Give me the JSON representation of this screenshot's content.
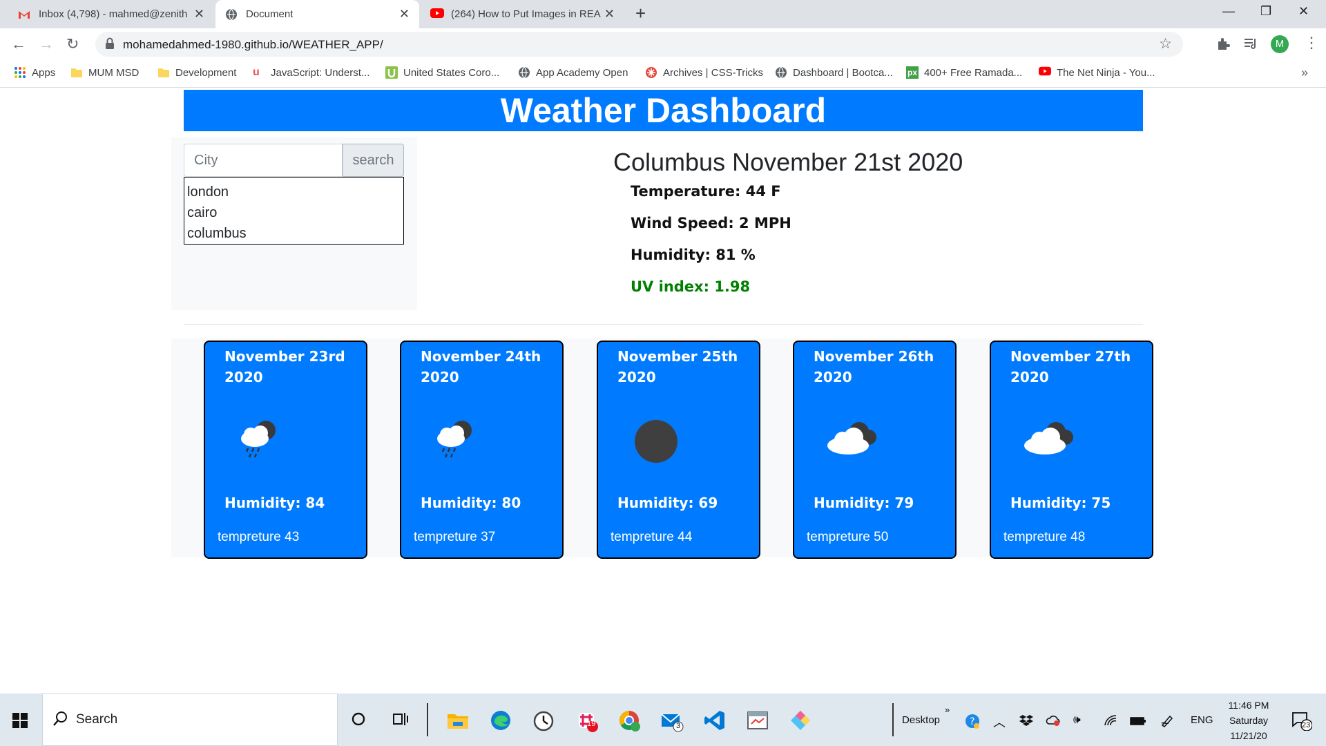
{
  "browser": {
    "tabs": [
      {
        "title": "Inbox (4,798) - mahmed@zenith",
        "icon": "gmail-icon"
      },
      {
        "title": "Document",
        "icon": "globe-icon"
      },
      {
        "title": "(264) How to Put Images in READ",
        "icon": "youtube-icon"
      }
    ],
    "new_tab": "+",
    "url": "mohamedahmed-1980.github.io/WEATHER_APP/",
    "profile_initial": "M",
    "bookmarks": [
      {
        "label": "Apps",
        "icon": "apps-grid-icon"
      },
      {
        "label": "MUM MSD",
        "icon": "folder-icon"
      },
      {
        "label": "Development",
        "icon": "folder-icon"
      },
      {
        "label": "JavaScript: Underst...",
        "icon": "udemy-icon"
      },
      {
        "label": "United States Coro...",
        "icon": "u-logo-icon"
      },
      {
        "label": "App Academy Open",
        "icon": "globe-icon"
      },
      {
        "label": "Archives | CSS-Tricks",
        "icon": "css-tricks-icon"
      },
      {
        "label": "Dashboard | Bootca...",
        "icon": "globe-icon"
      },
      {
        "label": "400+ Free Ramada...",
        "icon": "px-icon"
      },
      {
        "label": "The Net Ninja - You...",
        "icon": "youtube-icon"
      }
    ],
    "bookmarks_overflow": "»"
  },
  "app": {
    "title": "Weather Dashboard",
    "search": {
      "placeholder": "City",
      "button": "search"
    },
    "history": [
      "london",
      "cairo",
      "columbus"
    ],
    "current": {
      "heading": "Columbus November 21st 2020",
      "temperature": "Temperature: 44 F",
      "wind": "Wind Speed: 2 MPH",
      "humidity": "Humidity: 81 %",
      "uv": "UV index: 1.98",
      "uv_color": "#008000"
    },
    "forecast": [
      {
        "date": "November 23rd 2020",
        "icon": "rain-cloud-icon",
        "humidity": "Humidity: 84",
        "temp": "tempreture 43"
      },
      {
        "date": "November 24th 2020",
        "icon": "rain-cloud-icon",
        "humidity": "Humidity: 80",
        "temp": "tempreture 37"
      },
      {
        "date": "November 25th 2020",
        "icon": "dark-circle-icon",
        "humidity": "Humidity: 69",
        "temp": "tempreture 44"
      },
      {
        "date": "November 26th 2020",
        "icon": "cloudy-icon",
        "humidity": "Humidity: 79",
        "temp": "tempreture 50"
      },
      {
        "date": "November 27th 2020",
        "icon": "cloudy-icon",
        "humidity": "Humidity: 75",
        "temp": "tempreture 48"
      }
    ],
    "accent": "#007bff"
  },
  "taskbar": {
    "search": "Search",
    "desktop": "Desktop",
    "overflow": "»",
    "lang": "ENG",
    "time": "11:46 PM",
    "day": "Saturday",
    "date": "11/21/20",
    "slack_badge": "19",
    "mail_badge": "3",
    "notif_badge": "23"
  }
}
